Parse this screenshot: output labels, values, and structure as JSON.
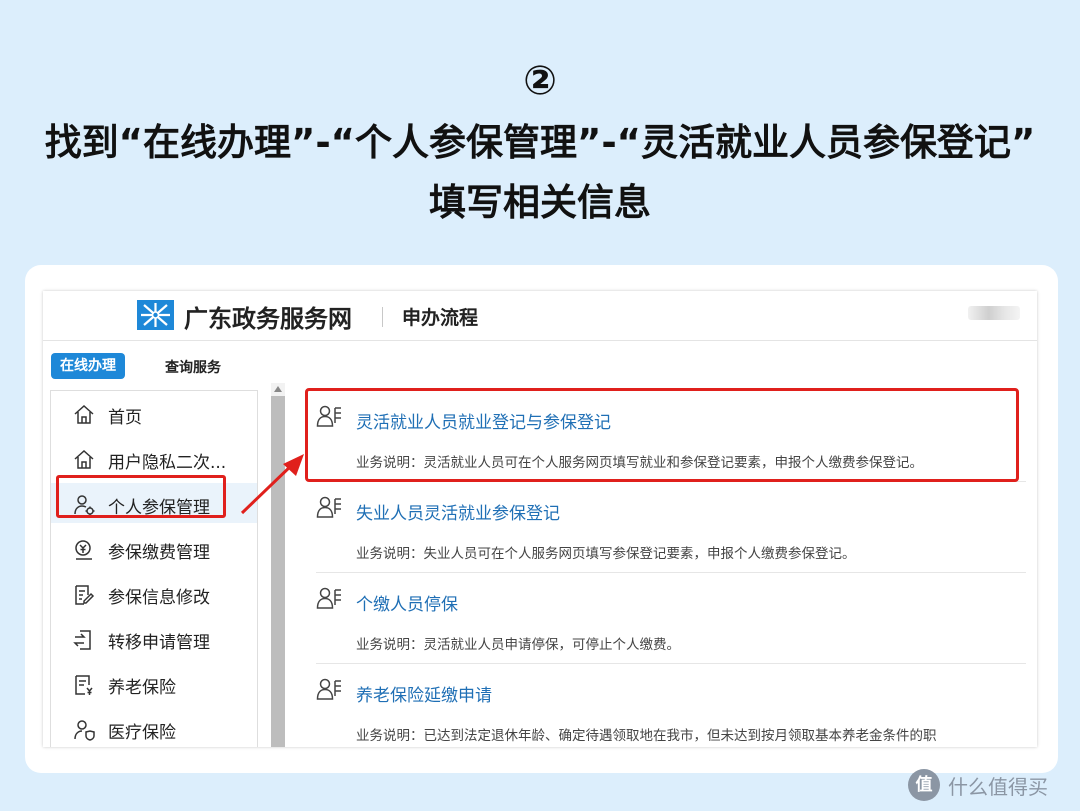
{
  "heading": {
    "step_number": "②",
    "line1": "找到“在线办理”-“个人参保管理”-“灵活就业人员参保登记”",
    "line2": "填写相关信息"
  },
  "portal": {
    "site_name": "广东政务服务网",
    "section": "申办流程",
    "tabs": [
      "在线办理",
      "查询服务"
    ]
  },
  "sidebar": {
    "items": [
      {
        "label": "首页",
        "icon": "home-icon"
      },
      {
        "label": "用户隐私二次...",
        "icon": "home-icon"
      },
      {
        "label": "个人参保管理",
        "icon": "person-gear-icon"
      },
      {
        "label": "参保缴费管理",
        "icon": "payment-icon"
      },
      {
        "label": "参保信息修改",
        "icon": "edit-document-icon"
      },
      {
        "label": "转移申请管理",
        "icon": "transfer-icon"
      },
      {
        "label": "养老保险",
        "icon": "document-yen-icon"
      },
      {
        "label": "医疗保险",
        "icon": "person-shield-icon"
      }
    ]
  },
  "services": [
    {
      "name": "灵活就业人员就业登记与参保登记",
      "desc": "业务说明：灵活就业人员可在个人服务网页填写就业和参保登记要素，申报个人缴费参保登记。"
    },
    {
      "name": "失业人员灵活就业参保登记",
      "desc": "业务说明：失业人员可在个人服务网页填写参保登记要素，申报个人缴费参保登记。"
    },
    {
      "name": "个缴人员停保",
      "desc": "业务说明：灵活就业人员申请停保，可停止个人缴费。"
    },
    {
      "name": "养老保险延缴申请",
      "desc": "业务说明：已达到法定退休年龄、确定待遇领取地在我市，但未达到按月领取基本养老金条件的职"
    }
  ],
  "watermark": {
    "logo_char": "值",
    "text": "什么值得买"
  },
  "colors": {
    "page_bg": "#dceefc",
    "accent_blue": "#1e88d8",
    "link_blue": "#1f6fb5",
    "highlight_red": "#e0201c"
  }
}
